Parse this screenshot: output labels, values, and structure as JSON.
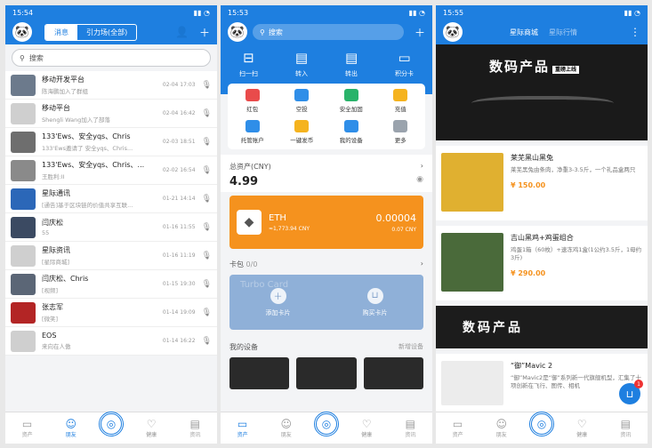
{
  "s1": {
    "time": "15:54",
    "tab_messages": "消息",
    "tab_plaza": "引力场(全部)",
    "search_placeholder": "搜索",
    "rows": [
      {
        "title": "移动开发平台",
        "sub": "陈海鹏加入了群组",
        "time": "02-04 17:03",
        "color": "#6c7a8c"
      },
      {
        "title": "移动平台",
        "sub": "Shengli Wang加入了部落",
        "time": "02-04 16:42",
        "color": "#cfcfcf"
      },
      {
        "title": "133'Ews、安全yqs、Chris",
        "sub": "133'Ews邀请了 安全yqs、Chris...",
        "time": "02-03 18:51",
        "color": "#6e6e6e"
      },
      {
        "title": "133'Ews、安全yqs、Chris、...",
        "sub": "王胜利:II",
        "time": "02-02 16:54",
        "color": "#8a8a8a"
      },
      {
        "title": "星际通讯",
        "sub": "[通告]基于区块链的价值共享互联...",
        "time": "01-21 14:14",
        "color": "#2b67b8"
      },
      {
        "title": "闫庆松",
        "sub": "55",
        "time": "01-16 11:55",
        "color": "#3b4a62"
      },
      {
        "title": "星际资讯",
        "sub": "[星际商城]",
        "time": "01-16 11:19",
        "color": "#cfcfcf"
      },
      {
        "title": "闫庆松、Chris",
        "sub": "[视频]",
        "time": "01-15 19:30",
        "color": "#5b6676"
      },
      {
        "title": "张志军",
        "sub": "[微笑]",
        "time": "01-14 19:09",
        "color": "#b32525"
      },
      {
        "title": "EOS",
        "sub": "来向在人傲",
        "time": "01-14 16:22",
        "color": "#cfcfcf"
      }
    ],
    "tabs": [
      "资产",
      "朋友",
      "",
      "健康",
      "资讯"
    ]
  },
  "s2": {
    "time": "15:53",
    "search_placeholder": "搜索",
    "big": [
      "扫一扫",
      "转入",
      "转出",
      "积分卡"
    ],
    "grid": [
      {
        "label": "红包",
        "color": "#e94b4b"
      },
      {
        "label": "空投",
        "color": "#2f8ee8"
      },
      {
        "label": "安全加固",
        "color": "#29b36a"
      },
      {
        "label": "充值",
        "color": "#f5b31e"
      },
      {
        "label": "托管账户",
        "color": "#2f8ee8"
      },
      {
        "label": "一键发币",
        "color": "#f5b31e"
      },
      {
        "label": "我的设备",
        "color": "#2f8ee8"
      },
      {
        "label": "更多",
        "color": "#9aa3ad"
      }
    ],
    "total_label": "总资产(CNY)",
    "total_value": "4.99",
    "eth_name": "ETH",
    "eth_price": "≈1,773.94 CNY",
    "eth_amount": "0.00004",
    "eth_cny": "0.07 CNY",
    "card_label": "卡包",
    "card_count": "0/0",
    "card_brand": "Turbo Card",
    "add_card": "添加卡片",
    "buy_card": "购买卡片",
    "devices_label": "我的设备",
    "add_device": "新增设备",
    "tabs": [
      "资产",
      "朋友",
      "",
      "健康",
      "资讯"
    ]
  },
  "s3": {
    "time": "15:55",
    "title": "星际商城",
    "subtitle": "星际行情",
    "banner_title": "数码产品",
    "banner_tag": "重磅上线",
    "products": [
      {
        "name": "莱芜黑山黑兔",
        "desc": "莱芜黑兔由条肉，净重3-3.5斤，一个礼品盒两只",
        "price": "¥ 150.00",
        "color": "#e0b030"
      },
      {
        "name": "吉山黑鸡+鸡蛋组合",
        "desc": "鸡蛋1箱（60枚）+速冻鸡1盒(1公约3.5斤，1母约3斤)",
        "price": "¥ 290.00",
        "color": "#4a6a3a"
      }
    ],
    "banner2_title": "数码产品",
    "mavic_name": "“御”Mavic 2",
    "mavic_desc": "“御”Mavic2是“御”系列新一代旗舰机型，汇集了十项创新在飞行、图传、相机",
    "cart_badge": "1",
    "tabs": [
      "资产",
      "朋友",
      "",
      "健康",
      "资讯"
    ]
  }
}
